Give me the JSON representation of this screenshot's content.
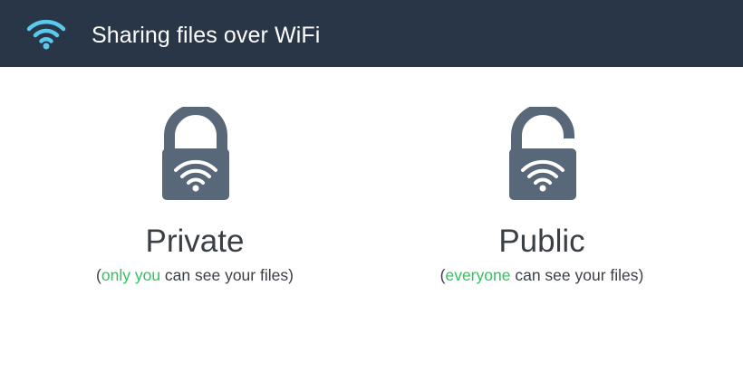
{
  "header": {
    "title": "Sharing files over WiFi",
    "icon": "wifi-icon",
    "icon_color": "#5bc8ee",
    "background": "#293647"
  },
  "options": [
    {
      "id": "private",
      "icon": "lock-closed-wifi-icon",
      "title": "Private",
      "desc_open": "(",
      "desc_highlight": "only you",
      "desc_rest": " can see your files)"
    },
    {
      "id": "public",
      "icon": "lock-open-wifi-icon",
      "title": "Public",
      "desc_open": "(",
      "desc_highlight": "everyone",
      "desc_rest": " can see your files)"
    }
  ],
  "colors": {
    "lock": "#586878",
    "highlight": "#2fc45b",
    "text": "#3a3f46"
  }
}
